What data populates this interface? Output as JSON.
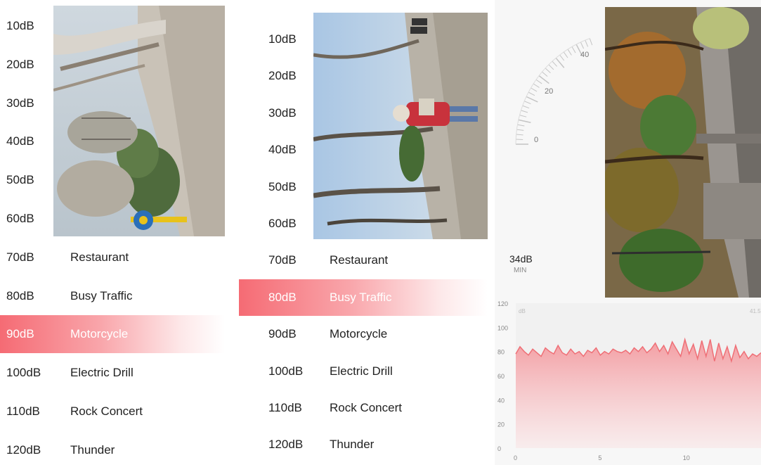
{
  "left_screen": {
    "levels": [
      {
        "db": "10dB",
        "label": ""
      },
      {
        "db": "20dB",
        "label": ""
      },
      {
        "db": "30dB",
        "label": ""
      },
      {
        "db": "40dB",
        "label": ""
      },
      {
        "db": "50dB",
        "label": ""
      },
      {
        "db": "60dB",
        "label": ""
      },
      {
        "db": "70dB",
        "label": "Restaurant"
      },
      {
        "db": "80dB",
        "label": "Busy Traffic"
      },
      {
        "db": "90dB",
        "label": "Motorcycle",
        "active": true
      },
      {
        "db": "100dB",
        "label": "Electric Drill"
      },
      {
        "db": "110dB",
        "label": "Rock Concert"
      },
      {
        "db": "120dB",
        "label": "Thunder"
      }
    ]
  },
  "middle_screen": {
    "levels": [
      {
        "db": "10dB",
        "label": ""
      },
      {
        "db": "20dB",
        "label": ""
      },
      {
        "db": "30dB",
        "label": ""
      },
      {
        "db": "40dB",
        "label": ""
      },
      {
        "db": "50dB",
        "label": ""
      },
      {
        "db": "60dB",
        "label": ""
      },
      {
        "db": "70dB",
        "label": "Restaurant"
      },
      {
        "db": "80dB",
        "label": "Busy Traffic",
        "active": true
      },
      {
        "db": "90dB",
        "label": "Motorcycle"
      },
      {
        "db": "100dB",
        "label": "Electric Drill"
      },
      {
        "db": "110dB",
        "label": "Rock Concert"
      },
      {
        "db": "120dB",
        "label": "Thunder"
      }
    ]
  },
  "right_screen": {
    "gauge": {
      "ticks": [
        "0",
        "20",
        "40"
      ]
    },
    "min_value": "34dB",
    "min_label": "MIN",
    "chart": {
      "y_axis_labels": [
        "120",
        "100",
        "80",
        "60",
        "40",
        "20",
        "0"
      ],
      "x_axis_labels": [
        "0",
        "5",
        "10"
      ],
      "unit_label": "dB",
      "corner_value": "41.5"
    }
  },
  "chart_data": {
    "type": "area",
    "xlabel": "",
    "ylabel": "",
    "ylim": [
      0,
      120
    ],
    "xlim": [
      0,
      14.5
    ],
    "series": [
      {
        "values": [
          78,
          84,
          80,
          77,
          82,
          79,
          76,
          83,
          80,
          78,
          85,
          79,
          77,
          82,
          78,
          80,
          76,
          81,
          79,
          83,
          77,
          80,
          78,
          82,
          80,
          79,
          81,
          78,
          83,
          80,
          84,
          79,
          82,
          87,
          80,
          85,
          78,
          88,
          82,
          76,
          90,
          78,
          86,
          74,
          89,
          76,
          90,
          72,
          87,
          74,
          84,
          72,
          85,
          75,
          80,
          74,
          78,
          76,
          79
        ]
      }
    ],
    "color": "#ef6f76"
  },
  "colors": {
    "accent": "#f56b74",
    "accent_light": "#fde7e8",
    "chart_fill": "#f9c5c8",
    "chart_line": "#ef6f76"
  }
}
